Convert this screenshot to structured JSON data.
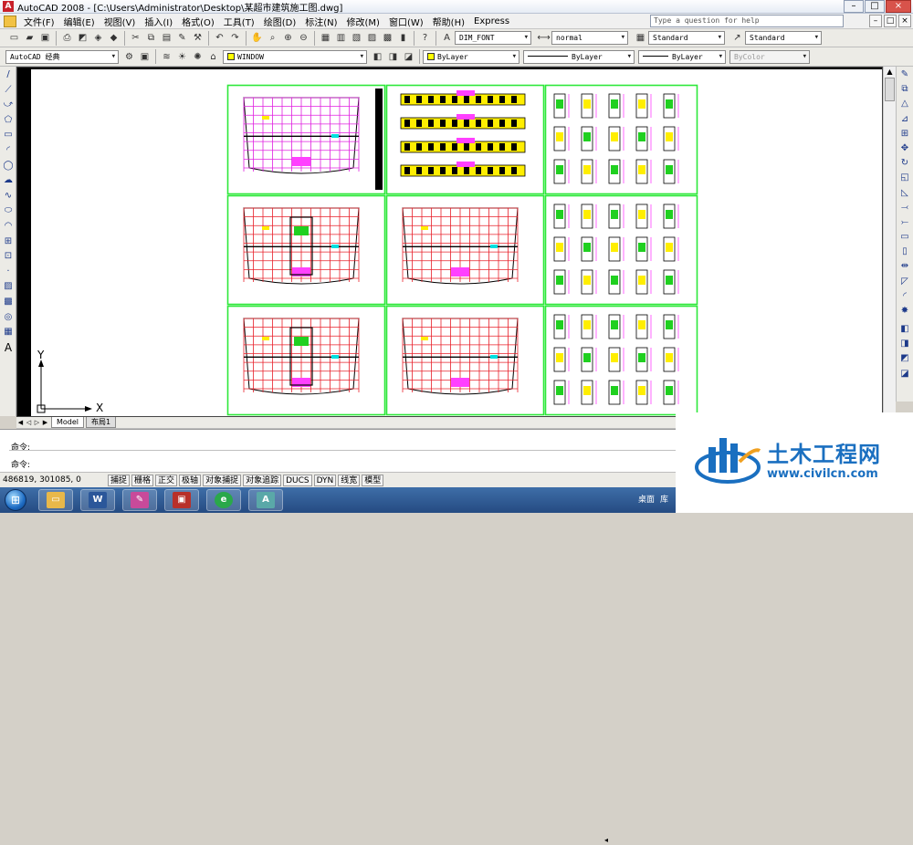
{
  "window": {
    "title": "AutoCAD 2008 - [C:\\Users\\Administrator\\Desktop\\某超市建筑施工图.dwg]",
    "app_icon": "A",
    "controls": [
      "–",
      "□",
      "×"
    ]
  },
  "menu": {
    "items": [
      "文件(F)",
      "编辑(E)",
      "视图(V)",
      "插入(I)",
      "格式(O)",
      "工具(T)",
      "绘图(D)",
      "标注(N)",
      "修改(M)",
      "窗口(W)",
      "帮助(H)",
      "Express"
    ],
    "help_placeholder": "Type a question for help",
    "doc_controls": [
      "–",
      "□",
      "×"
    ]
  },
  "toolbar_standard": {
    "text_style": "DIM_FONT",
    "dim_style": "normal",
    "table_style": "Standard",
    "multileader_style": "Standard"
  },
  "toolbar_layers": {
    "workspace": "AutoCAD 经典",
    "layer": "WINDOW",
    "color": "ByLayer",
    "linetype": "ByLayer",
    "lineweight": "ByLayer",
    "plotstyle": "ByColor"
  },
  "drawing": {
    "ucs_x": "X",
    "ucs_y": "Y",
    "accent": "#2ee83a"
  },
  "tabs": {
    "model": "Model",
    "layout": "布局1"
  },
  "command": {
    "line1": "命令:",
    "line2": "命令:"
  },
  "status": {
    "coords": "486819, 301085, 0",
    "buttons": [
      "捕捉",
      "栅格",
      "正交",
      "极轴",
      "对象捕捉",
      "对象追踪",
      "DUCS",
      "DYN",
      "线宽",
      "模型"
    ]
  },
  "taskbar": {
    "tray_text": "桌面",
    "tray_extra": "库"
  },
  "watermark": {
    "title": "土木工程网",
    "url": "www.civilcn.com"
  }
}
